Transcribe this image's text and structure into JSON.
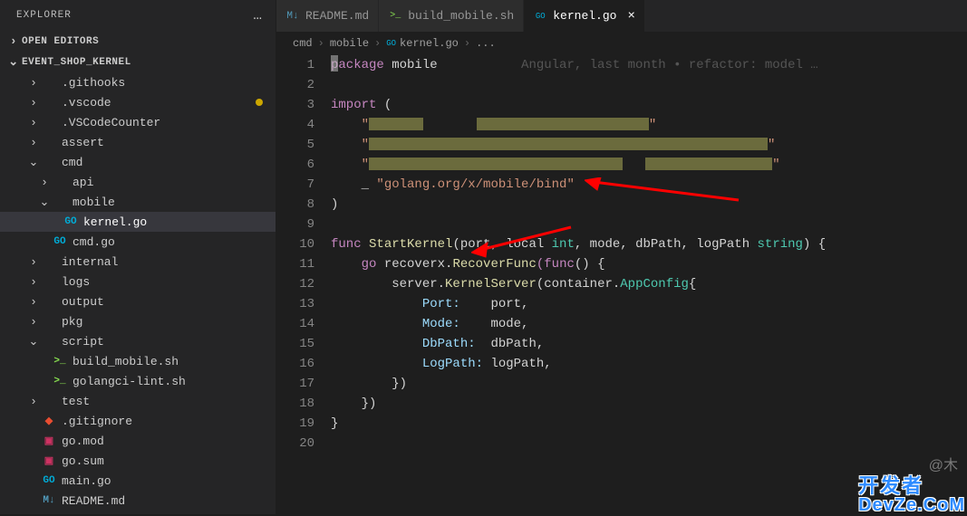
{
  "sidebar": {
    "title": "EXPLORER",
    "sections": {
      "open_editors": "OPEN EDITORS",
      "project": "EVENT_SHOP_KERNEL"
    },
    "items": [
      {
        "label": ".githooks",
        "type": "folder",
        "indent": 1,
        "chevron": "›"
      },
      {
        "label": ".vscode",
        "type": "folder",
        "indent": 1,
        "chevron": "›",
        "modified": true
      },
      {
        "label": ".VSCodeCounter",
        "type": "folder",
        "indent": 1,
        "chevron": "›"
      },
      {
        "label": "assert",
        "type": "folder",
        "indent": 1,
        "chevron": "›"
      },
      {
        "label": "cmd",
        "type": "folder",
        "indent": 1,
        "chevron": "⌄"
      },
      {
        "label": "api",
        "type": "folder",
        "indent": 2,
        "chevron": "›"
      },
      {
        "label": "mobile",
        "type": "folder",
        "indent": 2,
        "chevron": "⌄"
      },
      {
        "label": "kernel.go",
        "type": "go",
        "indent": 3,
        "selected": true
      },
      {
        "label": "cmd.go",
        "type": "go",
        "indent": 2
      },
      {
        "label": "internal",
        "type": "folder",
        "indent": 1,
        "chevron": "›"
      },
      {
        "label": "logs",
        "type": "folder",
        "indent": 1,
        "chevron": "›"
      },
      {
        "label": "output",
        "type": "folder",
        "indent": 1,
        "chevron": "›"
      },
      {
        "label": "pkg",
        "type": "folder",
        "indent": 1,
        "chevron": "›"
      },
      {
        "label": "script",
        "type": "folder",
        "indent": 1,
        "chevron": "⌄"
      },
      {
        "label": "build_mobile.sh",
        "type": "sh",
        "indent": 2
      },
      {
        "label": "golangci-lint.sh",
        "type": "sh",
        "indent": 2
      },
      {
        "label": "test",
        "type": "folder",
        "indent": 1,
        "chevron": "›"
      },
      {
        "label": ".gitignore",
        "type": "git",
        "indent": 1
      },
      {
        "label": "go.mod",
        "type": "mod",
        "indent": 1
      },
      {
        "label": "go.sum",
        "type": "mod",
        "indent": 1
      },
      {
        "label": "main.go",
        "type": "go",
        "indent": 1
      },
      {
        "label": "README.md",
        "type": "md",
        "indent": 1
      }
    ]
  },
  "tabs": [
    {
      "label": "README.md",
      "icon": "md"
    },
    {
      "label": "build_mobile.sh",
      "icon": "sh"
    },
    {
      "label": "kernel.go",
      "icon": "go",
      "active": true
    }
  ],
  "breadcrumb": [
    "cmd",
    "mobile",
    "kernel.go",
    "..."
  ],
  "code": {
    "line1_kw": "package",
    "line1_pkg": " mobile",
    "line1_anno": "           Angular, last month • refactor: model …",
    "line3_kw": "import",
    "line3_paren": " (",
    "line7_underscore": "    _ ",
    "line7_str": "\"golang.org/x/mobile/bind\"",
    "line8": ")",
    "line10_kw": "func",
    "line10_name": " StartKernel",
    "line10_sig1": "(port, local ",
    "line10_int": "int",
    "line10_sig2": ", mode, dbPath, logPath ",
    "line10_string": "string",
    "line10_sig3": ") {",
    "line11_go": "    go",
    "line11_recover": " recoverx.",
    "line11_rf": "RecoverFunc",
    "line11_func": "(func",
    "line11_rest": "() {",
    "line12": "        server.",
    "line12_ks": "KernelServer",
    "line12_rest": "(container.",
    "line12_ac": "AppConfig",
    "line12_brace": "{",
    "line13_k": "            Port:    ",
    "line13_v": "port",
    "line13_c": ",",
    "line14_k": "            Mode:    ",
    "line14_v": "mode",
    "line14_c": ",",
    "line15_k": "            DbPath:  ",
    "line15_v": "dbPath",
    "line15_c": ",",
    "line16_k": "            LogPath: ",
    "line16_v": "logPath",
    "line16_c": ",",
    "line17": "        })",
    "line18": "    })",
    "line19": "}"
  },
  "line_numbers": [
    "1",
    "2",
    "3",
    "4",
    "5",
    "6",
    "7",
    "8",
    "9",
    "10",
    "11",
    "12",
    "13",
    "14",
    "15",
    "16",
    "17",
    "18",
    "19",
    "20"
  ],
  "watermark_text": "@木",
  "watermark_logo_top": "开发者",
  "watermark_logo_bot": "DevZe.CoM"
}
